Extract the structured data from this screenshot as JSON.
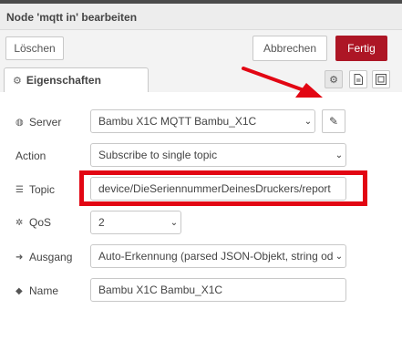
{
  "window": {
    "title": "Node 'mqtt in' bearbeiten"
  },
  "toolbar": {
    "delete_label": "Löschen",
    "cancel_label": "Abbrechen",
    "done_label": "Fertig"
  },
  "tabs": {
    "properties_label": "Eigenschaften",
    "icons": [
      "gear-icon",
      "document-icon",
      "frame-icon"
    ]
  },
  "form": {
    "server": {
      "label": "Server",
      "value": "Bambu X1C MQTT Bambu_X1C",
      "icon": "globe-icon"
    },
    "action": {
      "label": "Action",
      "value": "Subscribe to single topic"
    },
    "topic": {
      "label": "Topic",
      "value": "device/DieSeriennummerDeinesDruckers/report",
      "icon": "list-icon"
    },
    "qos": {
      "label": "QoS",
      "value": "2",
      "icon": "qos-icon"
    },
    "output": {
      "label": "Ausgang",
      "value": "Auto-Erkennung (parsed JSON-Objekt, string oder",
      "icon": "sign-out-icon"
    },
    "name": {
      "label": "Name",
      "value": "Bambu X1C Bambu_X1C",
      "icon": "tag-icon"
    }
  },
  "annotations": {
    "arrow_color": "#e20613",
    "highlight_color": "#e20613"
  },
  "colors": {
    "accent": "#ad1625"
  }
}
